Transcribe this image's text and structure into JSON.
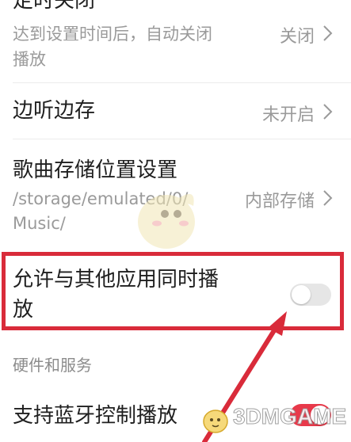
{
  "settings": {
    "auto_close": {
      "title": "定时关闭",
      "subtitle_line1": "达到设置时间后，自动关闭",
      "subtitle_line2": "播放",
      "value": "关闭"
    },
    "listen_save": {
      "title": "边听边存",
      "value": "未开启"
    },
    "storage": {
      "title": "歌曲存储位置设置",
      "path_line1": "/storage/emulated/0/",
      "path_line2": "Music/",
      "value": "内部存储"
    },
    "mix_playback": {
      "title_line1": "允许与其他应用同时播",
      "title_line2": "放",
      "enabled": false
    },
    "section_hardware": "硬件和服务",
    "bluetooth": {
      "title": "支持蓝牙控制播放",
      "enabled": true
    }
  },
  "colors": {
    "highlight": "#d92b3a",
    "toggle_on": "#e8394a",
    "toggle_off": "#e6e6e6"
  },
  "watermark": {
    "text": "3DMGAME",
    "icon": "mascot-icon"
  }
}
